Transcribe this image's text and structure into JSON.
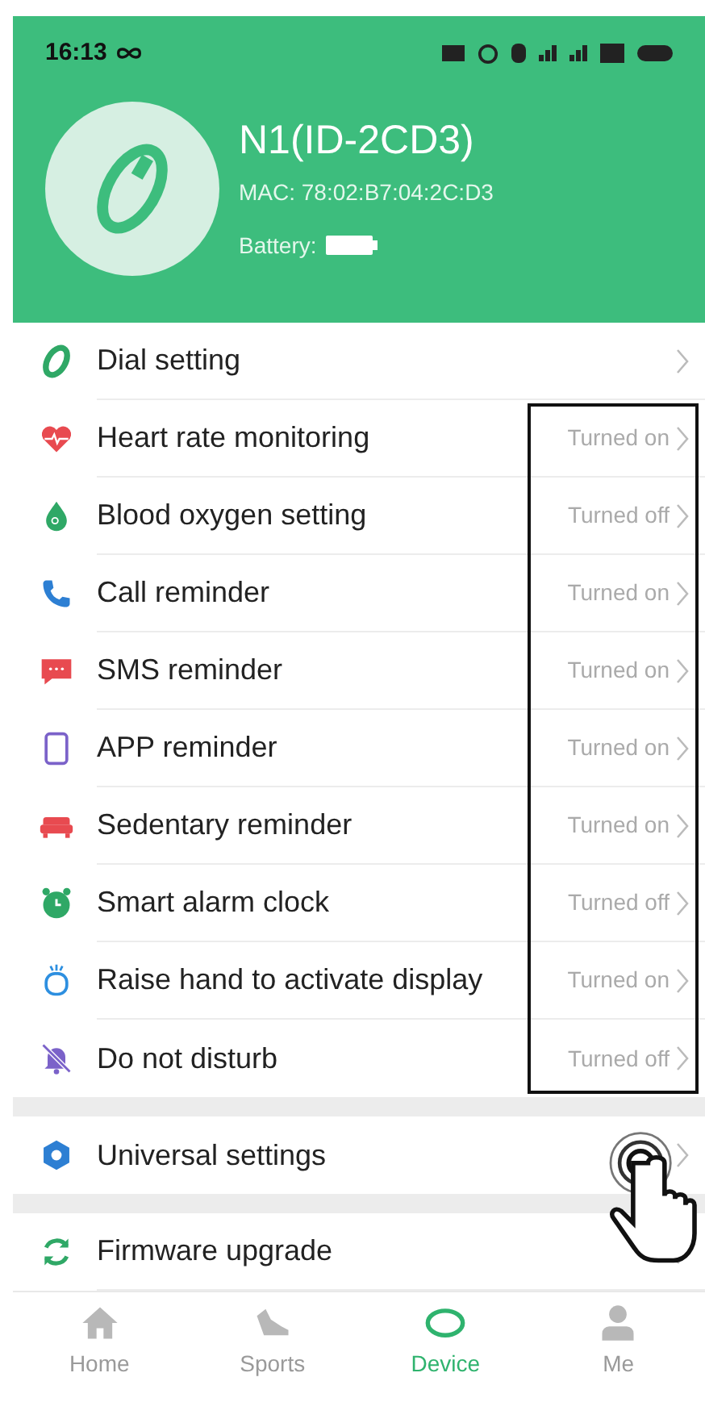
{
  "status_bar": {
    "time": "16:13"
  },
  "device": {
    "name": "N1(ID-2CD3)",
    "mac": "MAC: 78:02:B7:04:2C:D3",
    "battery_label": "Battery:"
  },
  "settings": [
    {
      "label": "Dial setting"
    },
    {
      "label": "Heart rate monitoring",
      "status": "Turned on"
    },
    {
      "label": "Blood oxygen setting",
      "status": "Turned off"
    },
    {
      "label": "Call reminder",
      "status": "Turned on"
    },
    {
      "label": "SMS reminder",
      "status": "Turned on"
    },
    {
      "label": "APP reminder",
      "status": "Turned on"
    },
    {
      "label": "Sedentary reminder",
      "status": "Turned on"
    },
    {
      "label": "Smart alarm clock",
      "status": "Turned off"
    },
    {
      "label": "Raise hand to activate display",
      "status": "Turned on"
    },
    {
      "label": "Do not disturb",
      "status": "Turned off"
    }
  ],
  "universal": {
    "label": "Universal settings"
  },
  "firmware": {
    "label": "Firmware upgrade"
  },
  "tabs": [
    {
      "label": "Home",
      "selected": false
    },
    {
      "label": "Sports",
      "selected": false
    },
    {
      "label": "Device",
      "selected": true
    },
    {
      "label": "Me",
      "selected": false
    }
  ]
}
